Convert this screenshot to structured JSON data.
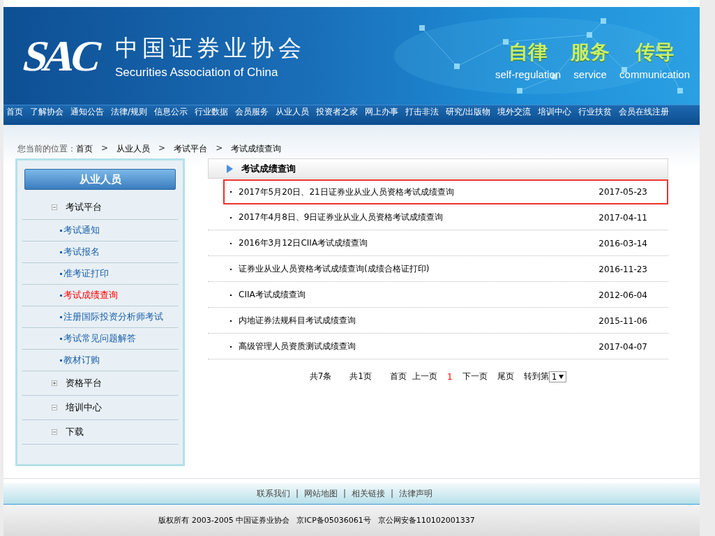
{
  "header": {
    "logo": "SAC",
    "org_name": "中国证券业协会",
    "org_name_en": "Securities Association of China",
    "slogans": [
      {
        "label": "自律",
        "label_en": "self-regulation"
      },
      {
        "label": "服务",
        "label_en": "service"
      },
      {
        "label": "传导",
        "label_en": "communication"
      }
    ]
  },
  "nav": [
    "首页",
    "了解协会",
    "通知公告",
    "法律/规则",
    "信息公示",
    "行业数据",
    "会员服务",
    "从业人员",
    "投资者之家",
    "网上办事",
    "打击非法",
    "研究/出版物",
    "境外交流",
    "培训中心",
    "行业扶贫",
    "会员在线注册"
  ],
  "breadcrumb": {
    "label": "您当前的位置：",
    "items": [
      "首页",
      "从业人员",
      "考试平台",
      "考试成绩查询"
    ],
    "separator": ">"
  },
  "sidebar": {
    "title": "从业人员",
    "sections": [
      {
        "label": "考试平台",
        "expanded": true,
        "children": [
          {
            "label": "考试通知",
            "selected": false
          },
          {
            "label": "考试报名",
            "selected": false
          },
          {
            "label": "准考证打印",
            "selected": false
          },
          {
            "label": "考试成绩查询",
            "selected": true
          },
          {
            "label": "注册国际投资分析师考试",
            "selected": false
          },
          {
            "label": "考试常见问题解答",
            "selected": false
          },
          {
            "label": "教材订购",
            "selected": false
          }
        ]
      },
      {
        "label": "资格平台",
        "expanded": false
      },
      {
        "label": "培训中心",
        "expanded": true
      },
      {
        "label": "下载",
        "expanded": true
      }
    ]
  },
  "content": {
    "title": "考试成绩查询",
    "items": [
      {
        "title": "2017年5月20日、21日证券业从业人员资格考试成绩查询",
        "date": "2017-05-23",
        "highlighted": true
      },
      {
        "title": "2017年4月8日、9日证券业从业人员资格考试成绩查询",
        "date": "2017-04-11",
        "highlighted": false
      },
      {
        "title": "2016年3月12日CIIA考试成绩查询",
        "date": "2016-03-14",
        "highlighted": false
      },
      {
        "title": "证券业从业人员资格考试成绩查询(成绩合格证打印)",
        "date": "2016-11-23",
        "highlighted": false
      },
      {
        "title": "CIIA考试成绩查询",
        "date": "2012-06-04",
        "highlighted": false
      },
      {
        "title": "内地证券法规科目考试成绩查询",
        "date": "2015-11-06",
        "highlighted": false
      },
      {
        "title": "高级管理人员资质测试成绩查询",
        "date": "2017-04-07",
        "highlighted": false
      }
    ],
    "pagination": {
      "total_items": "共7条",
      "total_pages": "共1页",
      "first": "首页",
      "prev": "上一页",
      "pages": [
        {
          "label": "1",
          "selected": true
        }
      ],
      "next": "下一页",
      "last": "尾页",
      "goto_label": "转到第",
      "goto_value": "1"
    }
  },
  "footer": {
    "separator": "|",
    "links": [
      "联系我们",
      "网站地图",
      "相关链接",
      "法律声明"
    ],
    "copyright": [
      "版权所有 2003-2005 中国证券业协会",
      "京ICP备05036061号",
      "京公网安备110102001337"
    ]
  }
}
